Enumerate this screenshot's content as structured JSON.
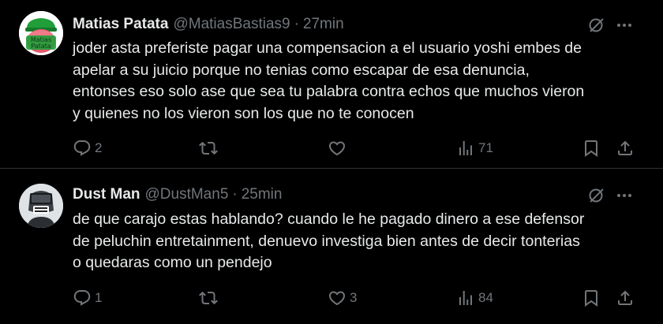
{
  "tweets": [
    {
      "name": "Matias Patata",
      "handle": "@MatiasBastias9",
      "separator": "·",
      "time": "27min",
      "avatar_text": [
        "Matias",
        "Patata"
      ],
      "avatar_icon": "green-hat-cartoon-avatar",
      "lines": [
        "joder asta preferiste pagar una compensacion a el usuario yoshi embes de",
        "apelar a su juicio porque no tenias como escapar de esa denuncia,",
        "entonses eso solo ase que sea tu palabra contra echos que muchos vieron",
        "y quienes no los vieron son los que no te conocen"
      ],
      "counts": {
        "replies": "2",
        "retweets": "",
        "likes": "",
        "views": "71"
      }
    },
    {
      "name": "Dust Man",
      "handle": "@DustMan5",
      "separator": "·",
      "time": "25min",
      "avatar_icon": "masked-character-avatar",
      "lines": [
        "de que carajo estas hablando? cuando le he pagado dinero a ese defensor",
        "de peluchin entretainment, denuevo investiga bien antes de decir tonterias",
        "o quedaras como un pendejo"
      ],
      "counts": {
        "replies": "1",
        "retweets": "",
        "likes": "3",
        "views": "84"
      }
    }
  ],
  "colors": {
    "background": "#000000",
    "text": "#e7e9ea",
    "muted": "#71767b",
    "divider": "#2f3336",
    "avatar_green": "#1f9e3a"
  },
  "icons": [
    "grok-icon",
    "more-icon",
    "reply-icon",
    "retweet-icon",
    "like-icon",
    "views-icon",
    "bookmark-icon",
    "share-icon"
  ]
}
